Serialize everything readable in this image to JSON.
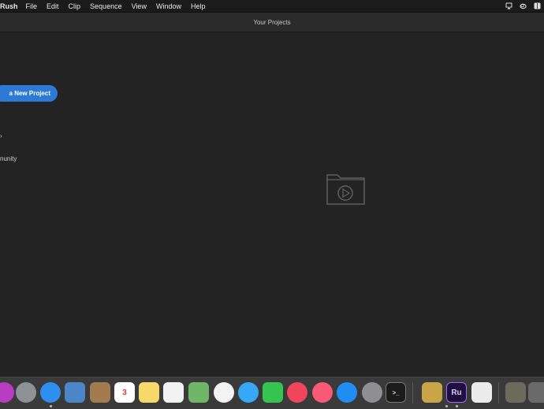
{
  "menubar": {
    "app_name": "Rush",
    "items": [
      "File",
      "Edit",
      "Clip",
      "Sequence",
      "View",
      "Window",
      "Help"
    ],
    "status_icons": [
      "airplay-icon",
      "creative-cloud-icon",
      "finder-icon"
    ]
  },
  "window": {
    "title": "Your Projects"
  },
  "sidebar": {
    "new_project_label": "a New Project",
    "text_fragment": "nunity"
  },
  "main": {
    "empty_state_icon": "folder-play-icon"
  },
  "dock": {
    "apps": [
      {
        "name": "siri-icon",
        "color": "#b83dc2"
      },
      {
        "name": "launchpad-icon",
        "color": "#8d9297"
      },
      {
        "name": "safari-icon",
        "color": "#2d8ff0"
      },
      {
        "name": "preview-icon",
        "color": "#4b86c8"
      },
      {
        "name": "contacts-icon",
        "color": "#a27b4f"
      },
      {
        "name": "calendar-icon",
        "color": "#ffffff",
        "text": "3"
      },
      {
        "name": "notes-icon",
        "color": "#f7d96b"
      },
      {
        "name": "reminders-icon",
        "color": "#f2f2f2"
      },
      {
        "name": "maps-icon",
        "color": "#6fb766"
      },
      {
        "name": "photos-icon",
        "color": "#f3f3f3"
      },
      {
        "name": "messages-icon",
        "color": "#36a8f6"
      },
      {
        "name": "facetime-icon",
        "color": "#34c44f"
      },
      {
        "name": "news-icon",
        "color": "#f0455b"
      },
      {
        "name": "music-icon",
        "color": "#fb5a77"
      },
      {
        "name": "app-store-icon",
        "color": "#1f8df2"
      },
      {
        "name": "system-preferences-icon",
        "color": "#8e8e93"
      },
      {
        "name": "terminal-icon",
        "color": "#1b1b1b"
      },
      {
        "name": "archive-utility-icon",
        "color": "#c9a548"
      },
      {
        "name": "premiere-rush-icon",
        "color": "#1f0f3c",
        "text": "Ru"
      },
      {
        "name": "textedit-icon",
        "color": "#ececec"
      },
      {
        "name": "folder-stack-icon",
        "color": "#6d6a5c"
      },
      {
        "name": "downloads-stack-icon",
        "color": "#6a6a6a"
      }
    ]
  }
}
